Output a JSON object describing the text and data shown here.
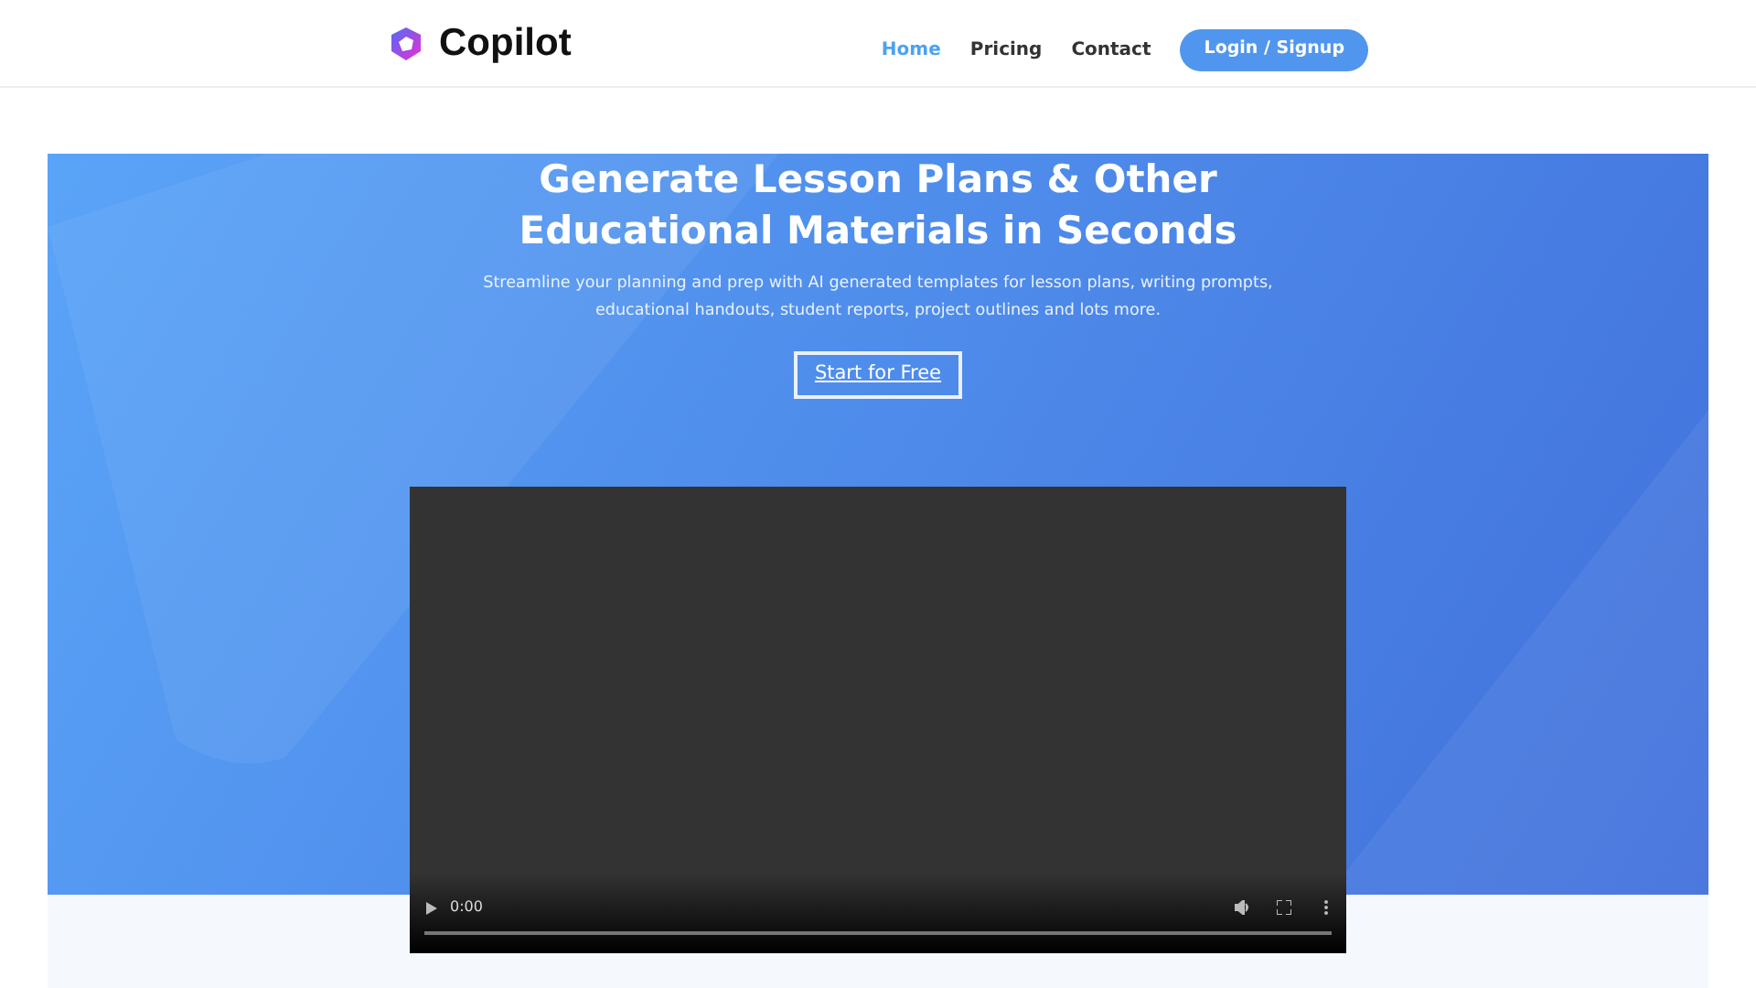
{
  "brand": {
    "name": "Copilot"
  },
  "nav": [
    {
      "label": "Home",
      "selected": true
    },
    {
      "label": "Pricing",
      "selected": false
    },
    {
      "label": "Contact",
      "selected": false
    }
  ],
  "login_button": "Login / Signup",
  "hero": {
    "title": "Generate Lesson Plans & Other Educational Materials in Seconds",
    "subtitle": "Streamline your planning and prep with AI generated templates for lesson plans, writing prompts, educational handouts, student reports, project outlines and lots more.",
    "cta": "Start for Free"
  },
  "video": {
    "time": "0:00"
  }
}
